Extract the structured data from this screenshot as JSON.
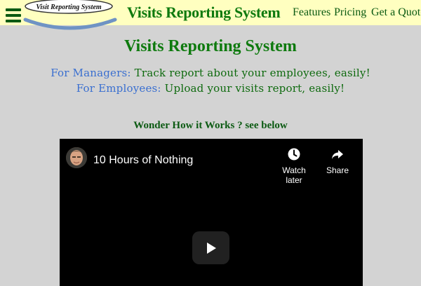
{
  "header": {
    "logo_text": "Visit Reporting System",
    "title": "Visits Reporting System",
    "nav": [
      {
        "label": "Features"
      },
      {
        "label": "Pricing"
      },
      {
        "label": "Get a Quote"
      }
    ],
    "menu_icon": "hamburger-menu-icon"
  },
  "main": {
    "title": "Visits Reporting System",
    "taglines": [
      {
        "label": "For Managers:",
        "text": "Track report about your employees, easily!"
      },
      {
        "label": "For Employees:",
        "text": "Upload your visits report, easily!"
      }
    ],
    "how_heading": "Wonder How it Works ? see below"
  },
  "video": {
    "title": "10 Hours of Nothing",
    "watch_later_label": "Watch later",
    "share_label": "Share",
    "icons": [
      "clock-icon",
      "share-arrow-icon",
      "play-icon"
    ]
  },
  "colors": {
    "header_bg": "#ffffc0",
    "page_bg": "#d3d3d3",
    "brand_green": "#0e7a0e",
    "label_blue": "#3a6fd0"
  }
}
